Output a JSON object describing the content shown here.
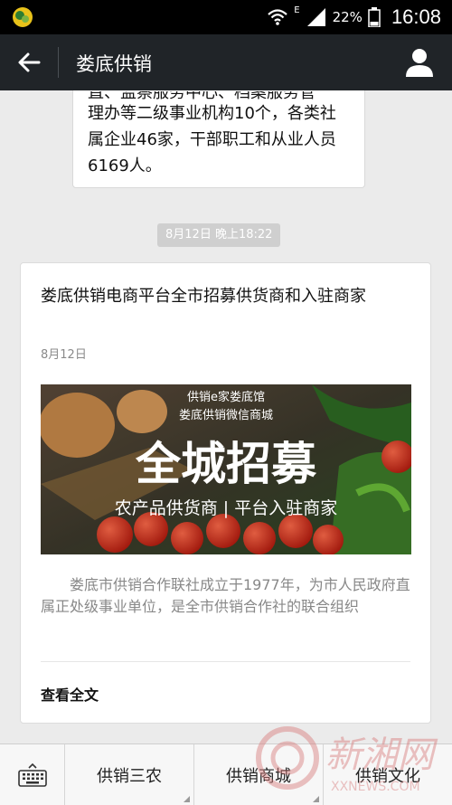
{
  "status_bar": {
    "network": "E",
    "battery": "22%",
    "time": "16:08"
  },
  "header": {
    "title": "娄底供销"
  },
  "messages": {
    "previous_bubble": {
      "cut_line": "直、监察服务中心、档案服务管",
      "text": "理办等二级事业机构10个，各类社属企业46家，干部职工和从业人员6169人。"
    },
    "timestamp": "8月12日 晚上18:22",
    "article": {
      "title": "娄底供销电商平台全市招募供货商和入驻商家",
      "date": "8月12日",
      "image": {
        "line1": "供销e家娄底馆",
        "line2": "娄底供销微信商城",
        "headline": "全城招募",
        "subline": "农产品供货商 | 平台入驻商家"
      },
      "summary": "娄底市供销合作联社成立于1977年，为市人民政府直属正处级事业单位，是全市供销合作社的联合组织",
      "read_more": "查看全文"
    }
  },
  "bottom_menu": {
    "items": [
      "供销三农",
      "供销商城",
      "供销文化"
    ]
  },
  "watermark": {
    "text": "新湘网",
    "sub": "XXNEWS.COM"
  },
  "colors": {
    "titlebar": "#202428",
    "background": "#ebebeb",
    "statusbar": "#000000"
  }
}
